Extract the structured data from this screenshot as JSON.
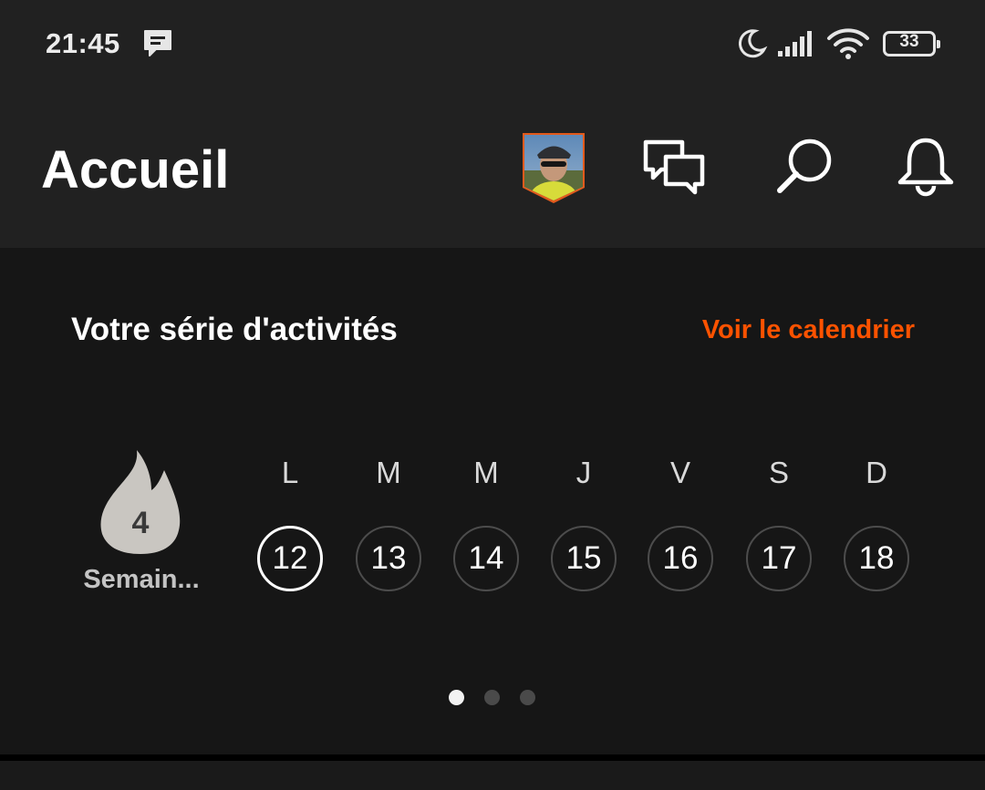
{
  "status_bar": {
    "time": "21:45",
    "battery": "33",
    "icons": [
      "message-notification-icon",
      "moon-icon",
      "signal-icon",
      "wifi-icon",
      "battery-icon"
    ]
  },
  "header": {
    "title": "Accueil",
    "icons": [
      "avatar",
      "chat-icon",
      "search-icon",
      "bell-icon"
    ]
  },
  "streak_card": {
    "title": "Votre série d'activités",
    "link": "Voir le calendrier",
    "streak_count": "4",
    "streak_label": "Semain...",
    "days": [
      {
        "letter": "L",
        "date": "12",
        "today": true
      },
      {
        "letter": "M",
        "date": "13",
        "today": false
      },
      {
        "letter": "M",
        "date": "14",
        "today": false
      },
      {
        "letter": "J",
        "date": "15",
        "today": false
      },
      {
        "letter": "V",
        "date": "16",
        "today": false
      },
      {
        "letter": "S",
        "date": "17",
        "today": false
      },
      {
        "letter": "D",
        "date": "18",
        "today": false
      }
    ],
    "pager": {
      "pages": 3,
      "active": 0
    }
  },
  "colors": {
    "accent": "#fc5200",
    "header_bg": "#212121",
    "card_bg": "#161616",
    "flame": "#c9c6c1"
  }
}
